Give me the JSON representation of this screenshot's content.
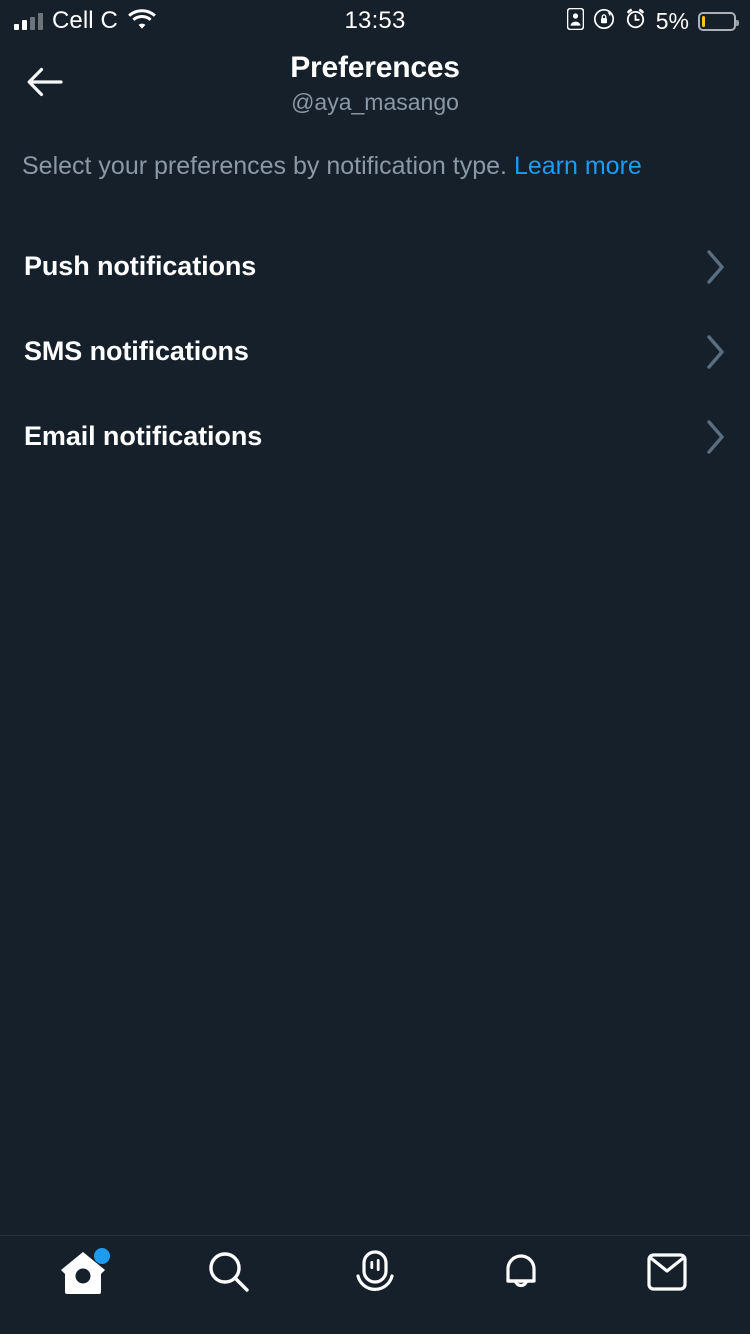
{
  "status_bar": {
    "carrier": "Cell C",
    "signal_bars_total": 4,
    "signal_bars_filled": 2,
    "wifi": "wifi-icon",
    "time": "13:53",
    "icons": [
      "portrait-orientation-badge-icon",
      "rotation-lock-icon",
      "alarm-clock-icon"
    ],
    "battery_percent": "5%",
    "battery_level": 5,
    "battery_color": "#F5C518"
  },
  "header": {
    "back": "back-arrow-icon",
    "title": "Preferences",
    "subtitle": "@aya_masango"
  },
  "description": {
    "text": "Select your preferences by notification type.",
    "link_label": "Learn more",
    "link_color": "#1D9BF0"
  },
  "preferences": {
    "rows": [
      {
        "label": "Push notifications",
        "chevron": "chevron-right-icon"
      },
      {
        "label": "SMS notifications",
        "chevron": "chevron-right-icon"
      },
      {
        "label": "Email notifications",
        "chevron": "chevron-right-icon"
      }
    ]
  },
  "tab_bar": {
    "tabs": [
      {
        "name": "home",
        "icon": "home-icon",
        "selected": true,
        "badge": true
      },
      {
        "name": "search",
        "icon": "search-icon",
        "selected": false,
        "badge": false
      },
      {
        "name": "spaces",
        "icon": "spaces-microphone-icon",
        "selected": false,
        "badge": false
      },
      {
        "name": "notifications",
        "icon": "bell-icon",
        "selected": false,
        "badge": false
      },
      {
        "name": "messages",
        "icon": "envelope-icon",
        "selected": false,
        "badge": false
      }
    ]
  },
  "theme": {
    "background": "#15202B",
    "text_primary": "#FFFFFF",
    "text_secondary": "#8B98A5",
    "accent": "#1D9BF0",
    "divider": "#25323D",
    "chevron": "#5B6E7F"
  }
}
